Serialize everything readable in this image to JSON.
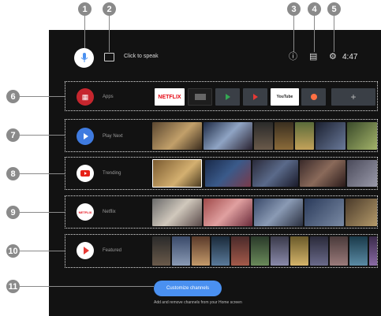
{
  "callouts": [
    "1",
    "2",
    "3",
    "4",
    "5",
    "6",
    "7",
    "8",
    "9",
    "10",
    "11"
  ],
  "header": {
    "mic_icon": "microphone-icon",
    "keyboard_icon": "keyboard-icon",
    "speak_label": "Click to speak",
    "notification_icon": "notification-icon",
    "input_icon": "input-source-icon",
    "settings_icon": "gear-icon",
    "time": "4:47"
  },
  "rows": [
    {
      "label": "Apps",
      "icon": "apps-grid-icon"
    },
    {
      "label": "Play Next",
      "icon": "play-next-icon"
    },
    {
      "label": "Trending",
      "icon": "youtube-icon"
    },
    {
      "label": "Netflix",
      "icon": "netflix-icon"
    },
    {
      "label": "Featured",
      "icon": "play-movies-icon"
    }
  ],
  "apps": {
    "netflix": "NETFLIX",
    "youtube": "YouTube",
    "plus": "+"
  },
  "customize": {
    "button_label": "Customize channels",
    "hint": "Add and remove channels from your Home screen"
  },
  "colors": {
    "accent": "#4a90f0",
    "youtube_red": "#e62117",
    "netflix_red": "#e50914",
    "callout_grey": "#8a8a8a"
  }
}
